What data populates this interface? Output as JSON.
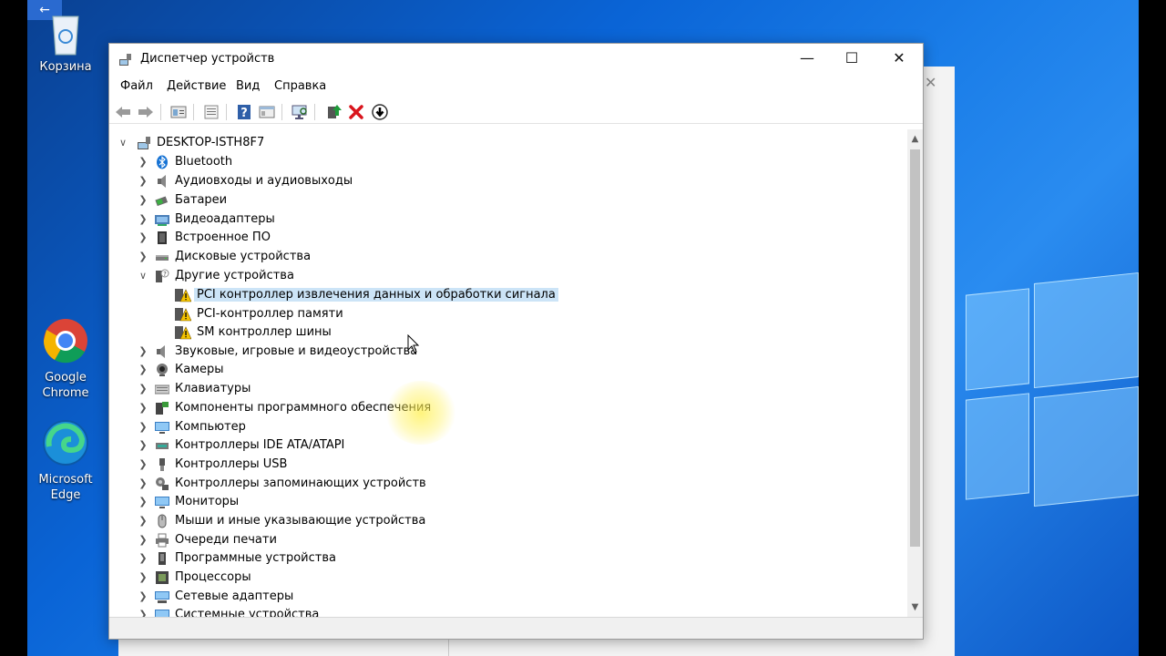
{
  "desktop": {
    "back_arrow": "←",
    "icons": [
      {
        "label": "Корзина"
      },
      {
        "label": "Google Chrome"
      },
      {
        "label": "Microsoft Edge"
      }
    ]
  },
  "window": {
    "title": "Диспетчер устройств",
    "controls": {
      "minimize": "—",
      "maximize": "☐",
      "close": "✕"
    },
    "menu": [
      "Файл",
      "Действие",
      "Вид",
      "Справка"
    ]
  },
  "tree": {
    "root": "DESKTOP-ISTH8F7",
    "items": [
      {
        "label": "Bluetooth",
        "icon": "bluetooth-icon",
        "expanded": false
      },
      {
        "label": "Аудиовходы и аудиовыходы",
        "icon": "audio-io-icon",
        "expanded": false
      },
      {
        "label": "Батареи",
        "icon": "battery-icon",
        "expanded": false
      },
      {
        "label": "Видеоадаптеры",
        "icon": "display-adapter-icon",
        "expanded": false
      },
      {
        "label": "Встроенное ПО",
        "icon": "firmware-icon",
        "expanded": false
      },
      {
        "label": "Дисковые устройства",
        "icon": "disk-icon",
        "expanded": false
      },
      {
        "label": "Другие устройства",
        "icon": "unknown-device-icon",
        "expanded": true,
        "children": [
          {
            "label": "PCI контроллер извлечения данных и обработки сигнала",
            "icon": "warning-device-icon",
            "selected": true
          },
          {
            "label": "PCI-контроллер памяти",
            "icon": "warning-device-icon"
          },
          {
            "label": "SM контроллер шины",
            "icon": "warning-device-icon"
          }
        ]
      },
      {
        "label": "Звуковые, игровые и видеоустройства",
        "icon": "speaker-icon",
        "expanded": false
      },
      {
        "label": "Камеры",
        "icon": "camera-icon",
        "expanded": false
      },
      {
        "label": "Клавиатуры",
        "icon": "keyboard-icon",
        "expanded": false
      },
      {
        "label": "Компоненты программного обеспечения",
        "icon": "software-component-icon",
        "expanded": false
      },
      {
        "label": "Компьютер",
        "icon": "computer-icon",
        "expanded": false
      },
      {
        "label": "Контроллеры IDE ATA/ATAPI",
        "icon": "ide-controller-icon",
        "expanded": false
      },
      {
        "label": "Контроллеры USB",
        "icon": "usb-icon",
        "expanded": false
      },
      {
        "label": "Контроллеры запоминающих устройств",
        "icon": "storage-controller-icon",
        "expanded": false
      },
      {
        "label": "Мониторы",
        "icon": "monitor-icon",
        "expanded": false
      },
      {
        "label": "Мыши и иные указывающие устройства",
        "icon": "mouse-icon",
        "expanded": false
      },
      {
        "label": "Очереди печати",
        "icon": "printer-icon",
        "expanded": false
      },
      {
        "label": "Программные устройства",
        "icon": "software-device-icon",
        "expanded": false
      },
      {
        "label": "Процессоры",
        "icon": "processor-icon",
        "expanded": false
      },
      {
        "label": "Сетевые адаптеры",
        "icon": "network-adapter-icon",
        "expanded": false
      },
      {
        "label": "Системные устройства",
        "icon": "system-device-icon",
        "expanded": false
      }
    ]
  },
  "toolbar": {
    "buttons": [
      "back-icon",
      "forward-icon",
      "properties-icon",
      "show-hide-tree-icon",
      "help-icon",
      "details-icon",
      "scan-hardware-icon",
      "update-driver-icon",
      "uninstall-icon",
      "disable-icon"
    ]
  },
  "colors": {
    "selection": "#cce4f7",
    "desktop": "#0a64d6",
    "highlight": "#fff050"
  }
}
